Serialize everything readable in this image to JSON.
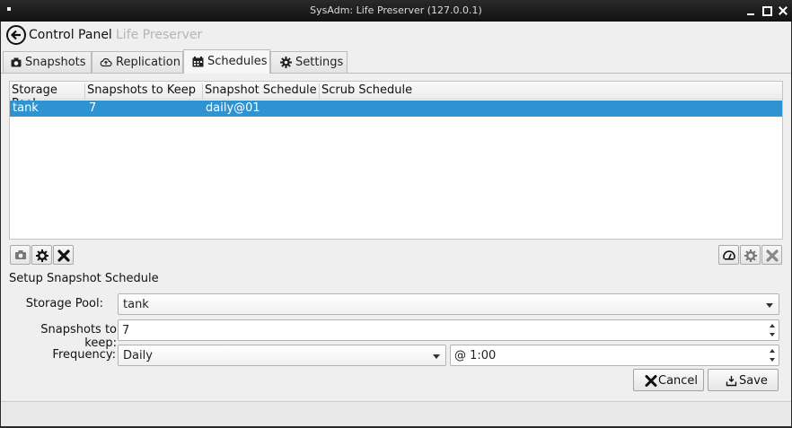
{
  "window": {
    "title": "SysAdm: Life Preserver (127.0.0.1)"
  },
  "nav": {
    "back_label": "Control Panel",
    "current_label": "Life Preserver"
  },
  "tabs": [
    {
      "label": "Snapshots",
      "icon": "camera-icon",
      "active": false
    },
    {
      "label": "Replication",
      "icon": "cloud-upload-icon",
      "active": false
    },
    {
      "label": "Schedules",
      "icon": "calendar-icon",
      "active": true
    },
    {
      "label": "Settings",
      "icon": "gear-icon",
      "active": false
    }
  ],
  "schedule_table": {
    "columns": [
      "Storage Pool",
      "Snapshots to Keep",
      "Snapshot Schedule",
      "Scrub Schedule"
    ],
    "rows": [
      {
        "storage_pool": "tank",
        "snapshots_to_keep": "7",
        "snapshot_schedule": "daily@01",
        "scrub_schedule": "",
        "selected": true
      }
    ]
  },
  "toolbar_left": [
    "camera-icon",
    "gear-icon",
    "remove-icon"
  ],
  "toolbar_right": [
    "gauge-icon",
    "gear-icon",
    "remove-icon"
  ],
  "setup": {
    "section_title": "Setup Snapshot Schedule",
    "storage_pool_label": "Storage Pool:",
    "storage_pool_value": "tank",
    "snapshots_keep_label": "Snapshots to keep:",
    "snapshots_keep_value": "7",
    "frequency_label": "Frequency:",
    "frequency_value": "Daily",
    "time_value": "@ 1:00",
    "cancel_label": "Cancel",
    "save_label": "Save"
  },
  "colors": {
    "selection": "#3093d1",
    "window_bg": "#efefef",
    "titlebar_bg": "#1c1c1c"
  }
}
